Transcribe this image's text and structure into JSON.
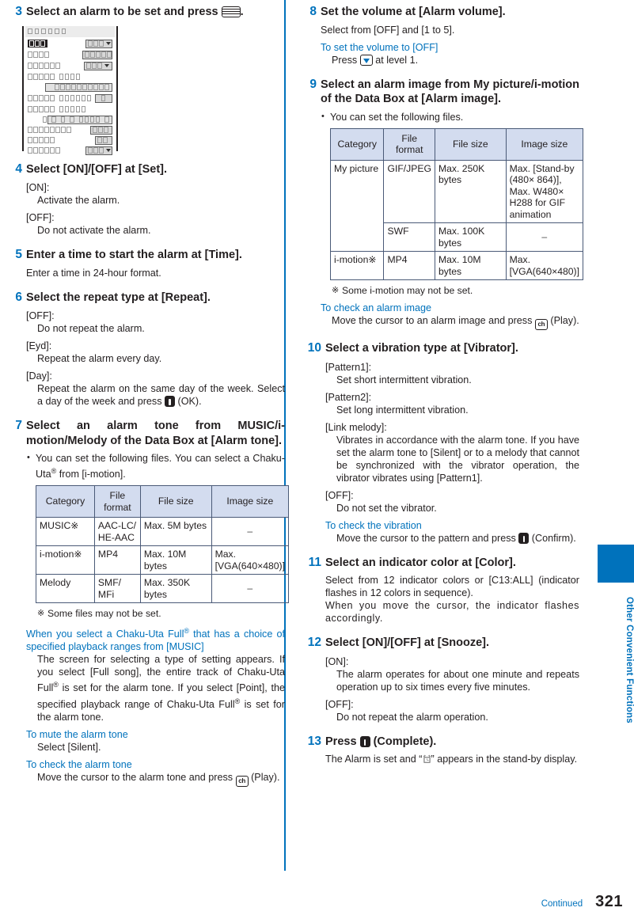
{
  "page": {
    "number": "321",
    "continued_label": "Continued",
    "side_tab_label": "Other Convenient Functions",
    "accent_color": "#0072bc",
    "table_header_color": "#d3dcef"
  },
  "left_column": {
    "steps": [
      {
        "num": "3",
        "title_prefix": "Select an alarm to be set and press ",
        "title_suffix": ".",
        "icon": "menu-key-icon",
        "screenshot": {
          "name": "alarm-setting-screen",
          "title_tofu_count": 6,
          "rows": [
            {
              "label_tofu": [
                3
              ],
              "selected": true,
              "field": {
                "tofu": 3,
                "caret": true,
                "type": "dropdown"
              }
            },
            {
              "label_tofu": [
                4
              ],
              "field": {
                "tofu": 5,
                "caret": false,
                "type": "box"
              }
            },
            {
              "label_tofu": [
                6
              ],
              "field": {
                "tofu": 3,
                "caret": true,
                "type": "dropdown"
              }
            },
            {
              "label_tofu": [
                5,
                4
              ],
              "field": null
            },
            {
              "label_tofu": [],
              "field": {
                "tofu": 10,
                "caret": false,
                "type": "wide"
              }
            },
            {
              "label_tofu": [
                5,
                6
              ],
              "field": {
                "tofu": 1,
                "caret": false,
                "type": "box"
              }
            },
            {
              "label_tofu": [
                5,
                5
              ],
              "field": null
            },
            {
              "label_tofu": [],
              "field": {
                "tofu": 9,
                "caret": false,
                "type": "wide-boxes"
              }
            },
            {
              "label_tofu": [
                8
              ],
              "field": {
                "tofu": 3,
                "caret": false,
                "type": "box"
              }
            },
            {
              "label_tofu": [
                5
              ],
              "field": {
                "tofu": 2,
                "caret": false,
                "type": "box"
              }
            },
            {
              "label_tofu": [
                6
              ],
              "field": {
                "tofu": 3,
                "caret": true,
                "type": "dropdown"
              }
            }
          ]
        }
      },
      {
        "num": "4",
        "title": "Select [ON]/[OFF] at [Set].",
        "terms": [
          {
            "term": "[ON]:",
            "def": "Activate the alarm."
          },
          {
            "term": "[OFF]:",
            "def": "Do not activate the alarm."
          }
        ]
      },
      {
        "num": "5",
        "title": "Enter a time to start the alarm at [Time].",
        "plain": "Enter a time in 24-hour format."
      },
      {
        "num": "6",
        "title": "Select the repeat type at [Repeat].",
        "terms": [
          {
            "term": "[OFF]:",
            "def": "Do not repeat the alarm."
          },
          {
            "term": "[Eyd]:",
            "def": "Repeat the alarm every day."
          },
          {
            "term": "[Day]:",
            "def_pre": "Repeat the alarm on the same day of the week. Select a day of the week and press ",
            "def_post": " (OK).",
            "icon": "select-key-icon"
          }
        ]
      },
      {
        "num": "7",
        "title": "Select an alarm tone from MUSIC/i-motion/Melody of the Data Box at [Alarm tone].",
        "bullets": [
          "You can set the following files. You can select a Chaku-Uta® from [i-motion]."
        ],
        "table": {
          "headers": [
            "Category",
            "File format",
            "File size",
            "Image size"
          ],
          "rows": [
            [
              "MUSIC※",
              "AAC-LC/ HE-AAC",
              "Max. 5M bytes",
              "–"
            ],
            [
              "i-motion※",
              "MP4",
              "Max. 10M bytes",
              "Max. [VGA(640×480)]"
            ],
            [
              "Melody",
              "SMF/ MFi",
              "Max. 350K bytes",
              "–"
            ]
          ]
        },
        "note": "Some files may not be set.",
        "subsections": [
          {
            "heading": "When you select a Chaku-Uta Full® that has a choice of specified playback ranges from [MUSIC]",
            "body": "The screen for selecting a type of setting appears. If you select [Full song], the entire track of Chaku-Uta Full® is set for the alarm tone. If you select [Point], the specified playback range of Chaku-Uta Full® is set for the alarm tone."
          },
          {
            "heading": "To mute the alarm tone",
            "body": "Select [Silent]."
          },
          {
            "heading": "To check the alarm tone",
            "body_pre": "Move the cursor to the alarm tone and press ",
            "body_post": " (Play).",
            "icon": "ch-play-key-icon"
          }
        ]
      }
    ]
  },
  "right_column": {
    "steps": [
      {
        "num": "8",
        "title": "Set the volume at [Alarm volume].",
        "plain": "Select from [OFF] and [1 to 5].",
        "subsections": [
          {
            "heading": "To set the volume to [OFF]",
            "body_pre": "Press ",
            "body_post": " at level 1.",
            "icon": "down-key-icon"
          }
        ]
      },
      {
        "num": "9",
        "title": "Select an alarm image from My picture/i-motion of the Data Box at [Alarm image].",
        "bullets": [
          "You can set the following files."
        ],
        "table": {
          "headers": [
            "Category",
            "File format",
            "File size",
            "Image size"
          ],
          "rows": [
            [
              "My picture",
              "GIF/JPEG",
              "Max. 250K bytes",
              "Max. [Stand-by (480× 864)], Max. W480× H288 for GIF animation"
            ],
            [
              "",
              "SWF",
              "Max. 100K bytes",
              "–"
            ],
            [
              "i-motion※",
              "MP4",
              "Max. 10M bytes",
              "Max. [VGA(640×480)]"
            ]
          ]
        },
        "note": "Some i-motion may not be set.",
        "subsections": [
          {
            "heading": "To check an alarm image",
            "body_pre": "Move the cursor to an alarm image and press ",
            "body_post": " (Play).",
            "icon": "ch-play-key-icon"
          }
        ]
      },
      {
        "num": "10",
        "title": "Select a vibration type at [Vibrator].",
        "terms": [
          {
            "term": "[Pattern1]:",
            "def": "Set short intermittent vibration."
          },
          {
            "term": "[Pattern2]:",
            "def": "Set long intermittent vibration."
          },
          {
            "term": "[Link melody]:",
            "def": "Vibrates in accordance with the alarm tone. If you have set the alarm tone to [Silent] or to a melody that cannot be synchronized with the vibrator operation, the vibrator vibrates using [Pattern1]."
          },
          {
            "term": "[OFF]:",
            "def": "Do not set the vibrator."
          }
        ],
        "subsections": [
          {
            "heading": "To check the vibration",
            "body_pre": "Move the cursor to the pattern and press ",
            "body_post": " (Confirm).",
            "icon": "select-key-icon"
          }
        ]
      },
      {
        "num": "11",
        "title": "Select an indicator color at [Color].",
        "plain": "Select from 12 indicator colors or [C13:ALL] (indicator flashes in 12 colors in sequence).",
        "plain2": "When you move the cursor, the indicator flashes accordingly."
      },
      {
        "num": "12",
        "title": "Select [ON]/[OFF] at [Snooze].",
        "terms": [
          {
            "term": "[ON]:",
            "def": "The alarm operates for about one minute and repeats operation up to six times every five minutes."
          },
          {
            "term": "[OFF]:",
            "def": "Do not repeat the alarm operation."
          }
        ]
      },
      {
        "num": "13",
        "title_pre": "Press ",
        "title_post": " (Complete).",
        "icon": "select-key-icon",
        "plain_pre": "The Alarm is set and “",
        "plain_post": "” appears in the stand-by display.",
        "inline_glyph": "alarm-clock-glyph"
      }
    ]
  }
}
